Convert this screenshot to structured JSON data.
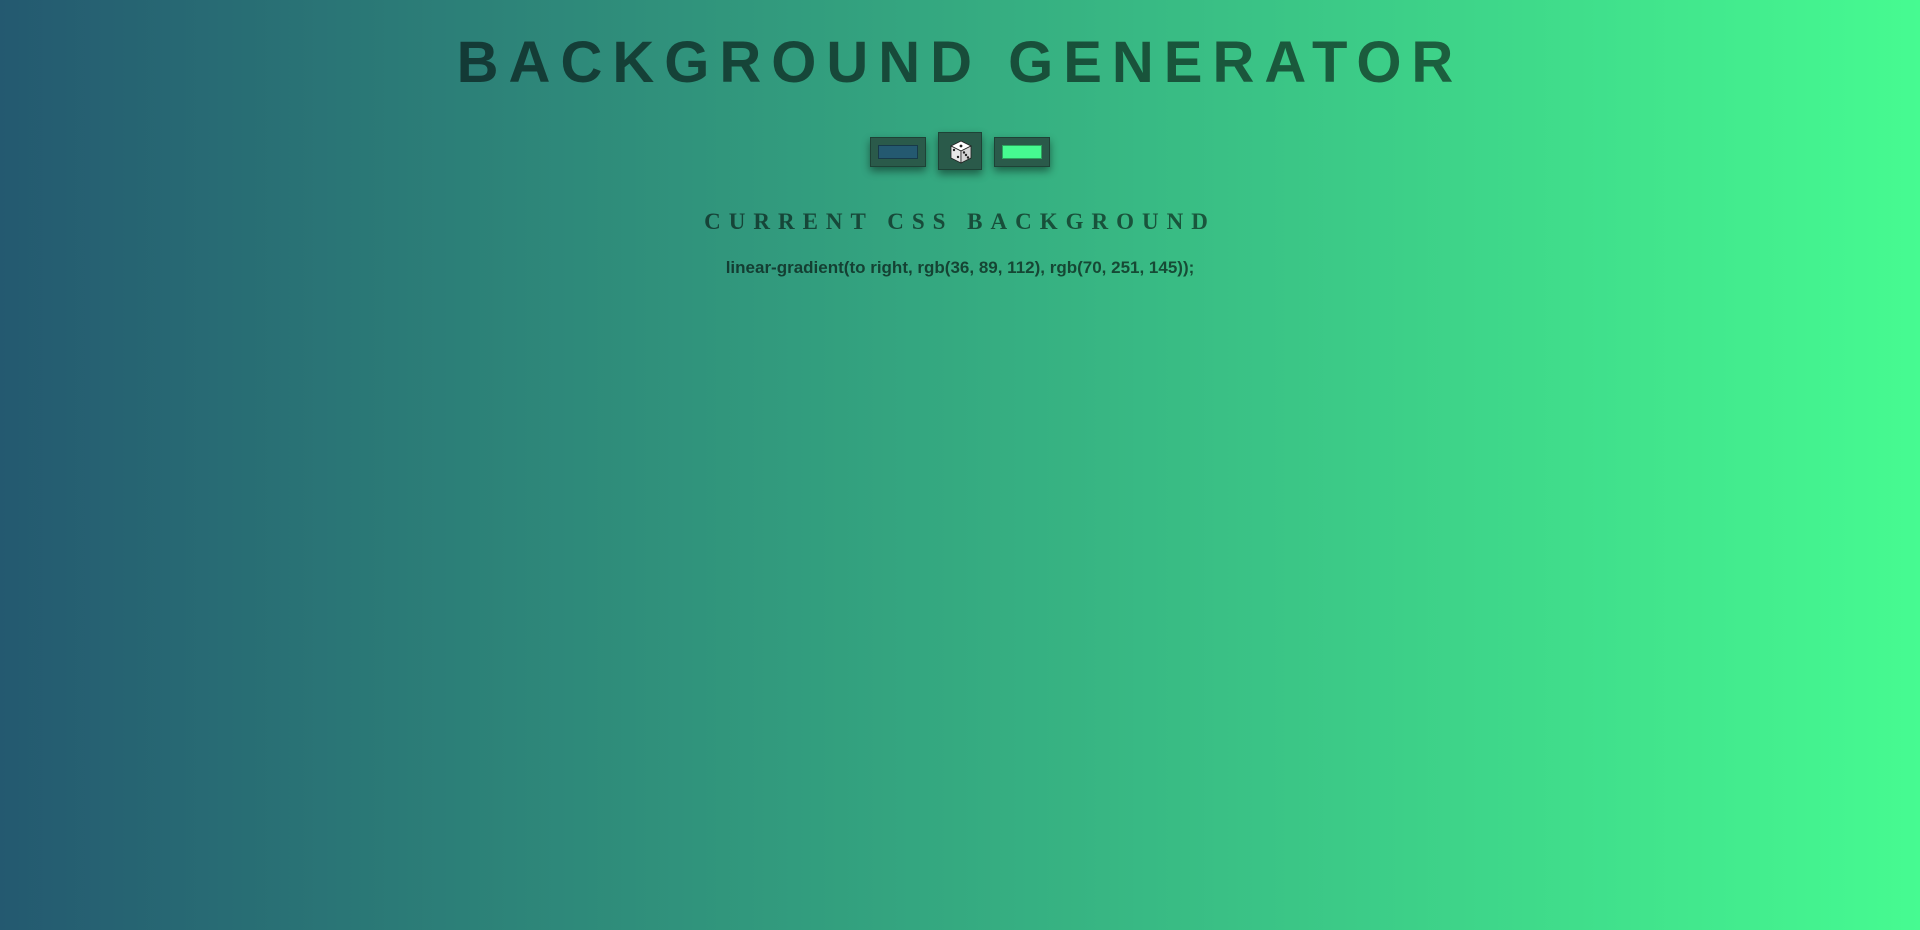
{
  "header": {
    "title": "BACKGROUND GENERATOR"
  },
  "controls": {
    "color1": "#245970",
    "color2": "#46fb91",
    "randomize_icon": "dice-icon"
  },
  "output": {
    "label": "CURRENT CSS BACKGROUND",
    "css_text": "linear-gradient(to right, rgb(36, 89, 112), rgb(70, 251, 145));"
  },
  "colors": {
    "gradient_start": "#245970",
    "gradient_end": "#46fb91",
    "button_bg": "#2a5a4a"
  }
}
